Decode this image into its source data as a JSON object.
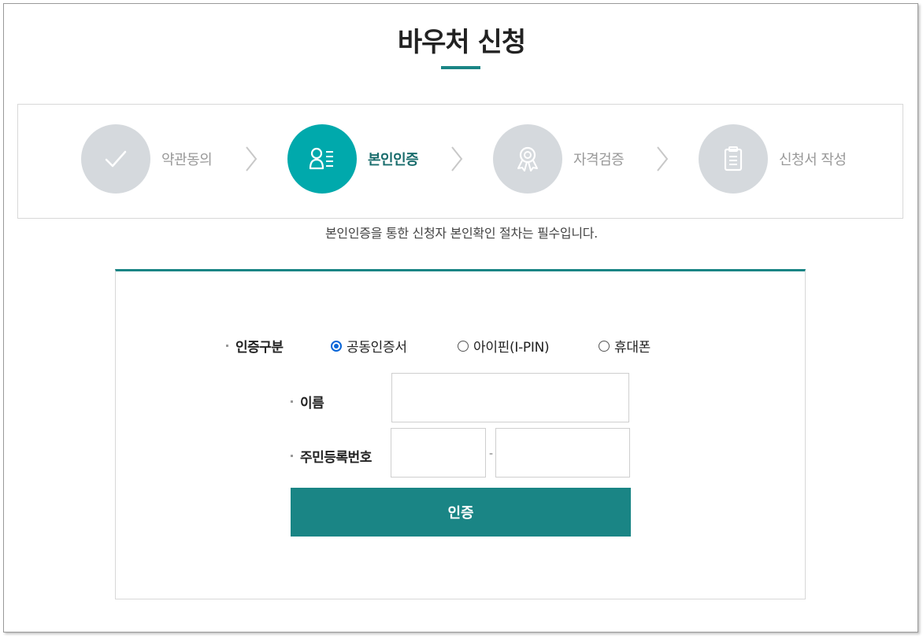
{
  "page": {
    "title": "바우처 신청",
    "notice": "본인인증을 통한 신청자 본인확인 절차는 필수입니다."
  },
  "steps": [
    {
      "label": "약관동의",
      "icon": "check-icon",
      "active": false
    },
    {
      "label": "본인인증",
      "icon": "person-list-icon",
      "active": true
    },
    {
      "label": "자격검증",
      "icon": "award-ribbon-icon",
      "active": false
    },
    {
      "label": "신청서 작성",
      "icon": "clipboard-icon",
      "active": false
    }
  ],
  "form": {
    "auth_type_label": "인증구분",
    "options": [
      {
        "label": "공동인증서",
        "checked": true
      },
      {
        "label": "아이핀(I-PIN)",
        "checked": false
      },
      {
        "label": "휴대폰",
        "checked": false
      }
    ],
    "name_label": "이름",
    "name_value": "",
    "rrn_label": "주민등록번호",
    "rrn_front_value": "",
    "rrn_back_value": "",
    "rrn_separator": "-",
    "submit_label": "인증"
  },
  "colors": {
    "accent": "#1a8585",
    "step_active": "#00a9ac",
    "step_inactive": "#d5d9dd",
    "radio_checked": "#0a66d8"
  }
}
